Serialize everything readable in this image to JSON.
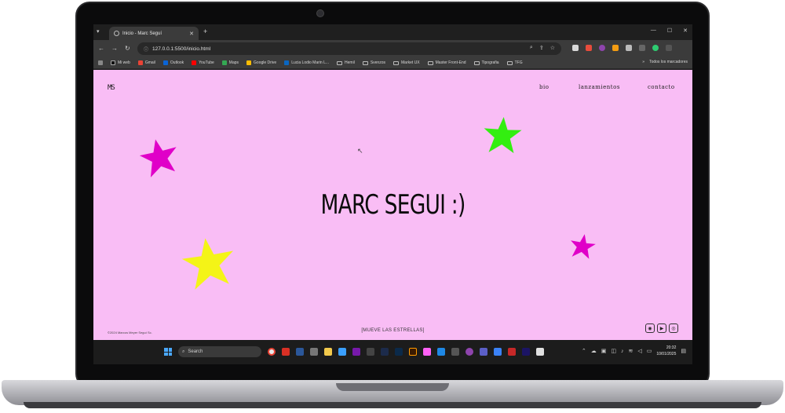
{
  "browser": {
    "tab_title": "Inicio - Marc Seguí",
    "url": "127.0.0.1:5500/inicio.html",
    "bookmarks": [
      "Mi web",
      "Gmail",
      "Outlook",
      "YouTube",
      "Maps",
      "Google Drive",
      "Lucia Lodio Marin L...",
      "Hemil",
      "Svenzos",
      "Market UX",
      "Master Front-End",
      "Tipografia",
      "TFG"
    ],
    "bookmarks_other": "Todos los marcadores"
  },
  "page": {
    "logo": "MS",
    "nav": [
      "bio",
      "lanzamientos",
      "contacto"
    ],
    "hero_title": "MARC SEGUI :)",
    "copyright": "©2024 Marcos Meyer Seguí Sc.",
    "cta": "[MUEVE LAS ESTRELLAS]",
    "socials": [
      "spotify-icon",
      "youtube-icon",
      "instagram-icon"
    ]
  },
  "stars": [
    {
      "color": "#e000c8"
    },
    {
      "color": "#33ee11"
    },
    {
      "color": "#f4f417"
    },
    {
      "color": "#e000c8"
    }
  ],
  "taskbar": {
    "search_label": "Search",
    "time": "20:32",
    "date": "10/01/2025"
  }
}
